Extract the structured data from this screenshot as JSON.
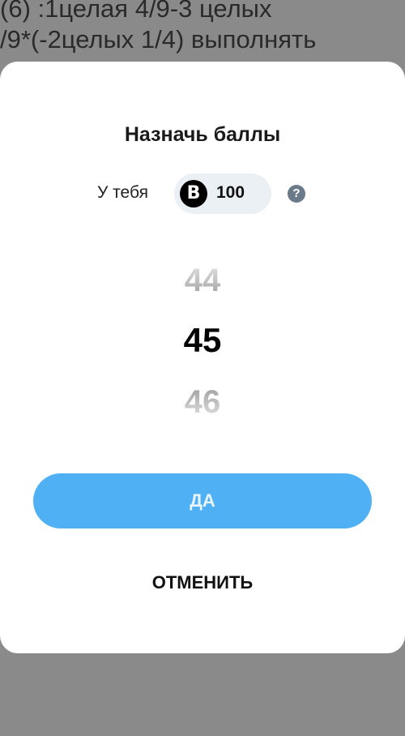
{
  "background": {
    "lines": [
      "(6) :1целая 4/9-3 целых",
      "/9*(-2целых 1/4) выполнять"
    ]
  },
  "modal": {
    "title": "Назначь баллы",
    "balance": {
      "label": "У тебя",
      "coin_symbol": "B",
      "value": "100",
      "help_symbol": "?"
    },
    "picker": {
      "previous": "44",
      "selected": "45",
      "next": "46"
    },
    "confirm_label": "ДА",
    "cancel_label": "ОТМЕНИТЬ"
  },
  "colors": {
    "accent": "#4fb1f3",
    "overlay": "#8a8a8a",
    "pill": "#ebf0f4"
  }
}
